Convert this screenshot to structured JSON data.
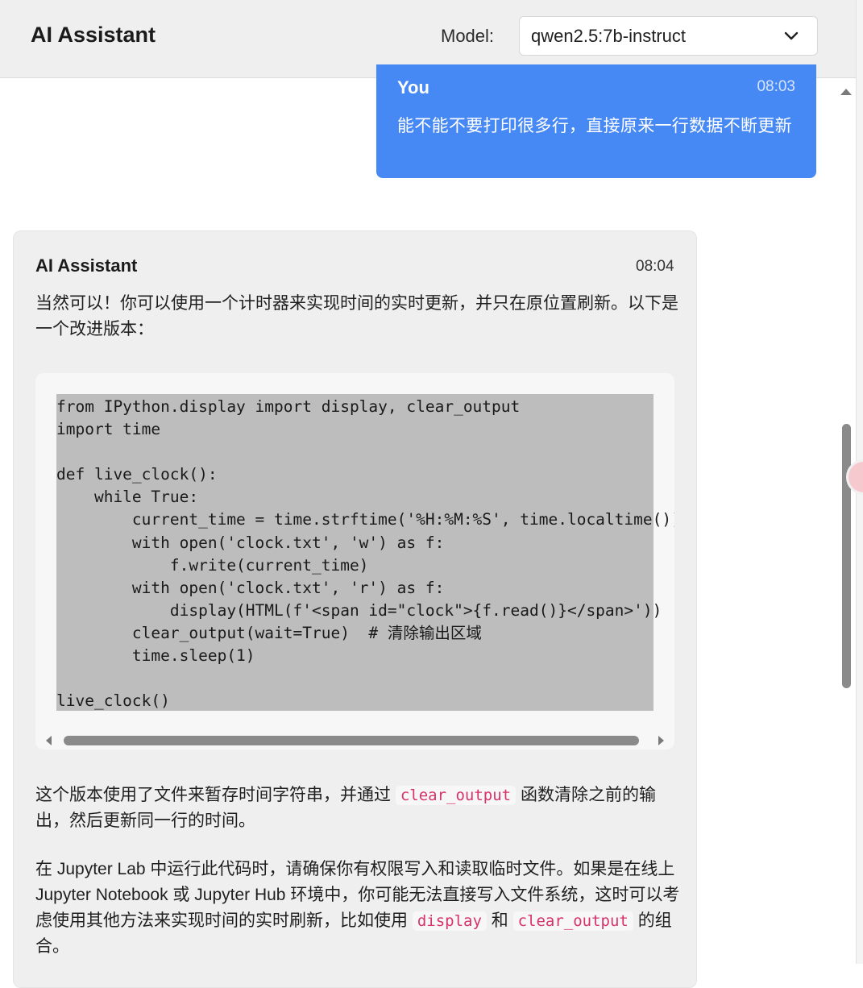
{
  "header": {
    "title": "AI Assistant",
    "model_label": "Model:",
    "model_selected": "qwen2.5:7b-instruct"
  },
  "icons": {
    "dropdown": "chevron-down-icon",
    "scroll_up": "triangle-up-icon",
    "floating": "floating-action-icon"
  },
  "colors": {
    "user_bubble": "#4688f4",
    "ai_bubble": "#efefef",
    "code_bg": "#bdbdbd",
    "inline_code": "#d6336c"
  },
  "messages": {
    "user": {
      "sender": "You",
      "time": "08:03",
      "text": "能不能不要打印很多行，直接原来一行数据不断更新"
    },
    "assistant": {
      "sender": "AI Assistant",
      "time": "08:04",
      "intro": "当然可以！你可以使用一个计时器来实现时间的实时更新，并只在原位置刷新。以下是一个改进版本：",
      "code_lines": [
        "from IPython.display import display, clear_output",
        "import time",
        "",
        "def live_clock():",
        "    while True:",
        "        current_time = time.strftime('%H:%M:%S', time.localtime())",
        "        with open('clock.txt', 'w') as f:",
        "            f.write(current_time)",
        "        with open('clock.txt', 'r') as f:",
        "            display(HTML(f'<span id=\"clock\">{f.read()}</span>'))",
        "        clear_output(wait=True)  # 清除输出区域",
        "        time.sleep(1)",
        "",
        "live_clock()"
      ],
      "p2_before": "这个版本使用了文件来暂存时间字符串，并通过 ",
      "p2_code": "clear_output",
      "p2_after": " 函数清除之前的输出，然后更新同一行的时间。",
      "p3_before": "在 Jupyter Lab 中运行此代码时，请确保你有权限写入和读取临时文件。如果是在线上 Jupyter Notebook 或 Jupyter Hub 环境中，你可能无法直接写入文件系统，这时可以考虑使用其他方法来实现时间的实时刷新，比如使用 ",
      "p3_code1": "display",
      "p3_mid": " 和 ",
      "p3_code2": "clear_output",
      "p3_after": " 的组合。"
    }
  }
}
